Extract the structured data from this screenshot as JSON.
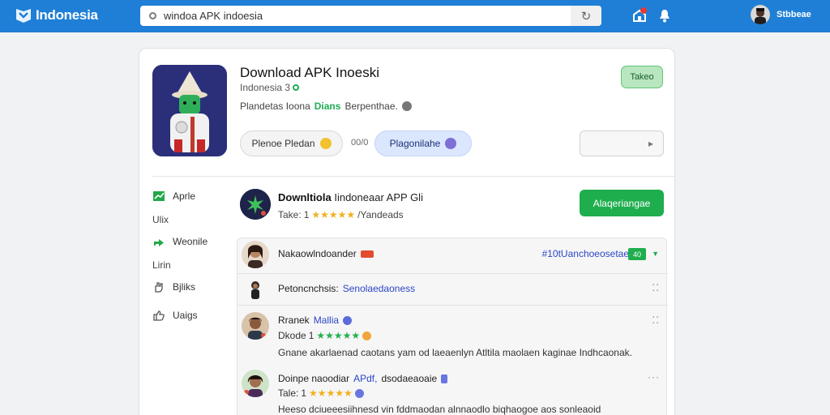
{
  "topbar": {
    "logo_text": "Indonesia",
    "search_value": "windoa APK indoesia",
    "user_name": "Stbbeae"
  },
  "app": {
    "title": "Download APK Inoeski",
    "subtitle": "Indonesia 3",
    "meta_prefix": "Plandetas Ioona",
    "meta_green": "Dians",
    "meta_suffix": "Berpenthae.",
    "badge_label": "Takeo",
    "pill_a_label": "Plenoe Pledan",
    "pill_sep": "00/0",
    "pill_b_label": "Plagonilahe"
  },
  "sidebar": {
    "items": [
      {
        "label": "Aprle",
        "icon": "chart-icon"
      },
      {
        "label": "Ulix"
      },
      {
        "label": "Weonile",
        "icon": "share-icon"
      },
      {
        "label": "Lirin"
      },
      {
        "label": "Bjliks",
        "icon": "hand-icon"
      },
      {
        "label": "Uaigs",
        "icon": "thumb-icon"
      }
    ]
  },
  "download": {
    "title_bold": "Downltiola",
    "title_rest": "Iindoneaar APP Gli",
    "rate_prefix": "Take:",
    "rate_num": "1",
    "stars": "★★★★★",
    "rate_suffix": "/Yandeads",
    "button_label": "Alaqeriangae"
  },
  "reviews": {
    "header_name": "Nakaowlndoander",
    "header_link": "#10tUanchoeosetae",
    "header_count": "40",
    "rows": [
      {
        "name": "Petoncnchsis:",
        "name_blue": "Senolaedaoness"
      },
      {
        "name": "Rranek",
        "name_blue": "Mallia",
        "rate_prefix": "Dkode",
        "rate_num": "1",
        "stars": "★★★★★",
        "text": "Gnane akarlaenad caotans yam od laeaenlyn Atltila maolaen kaginae Indhcaonak."
      },
      {
        "name": "Doinpe naoodiar",
        "name_blue": "APdf,",
        "name_rest": "dsodaeaoaie",
        "rate_prefix": "Tale:",
        "rate_num": "1",
        "stars": "★★★★★",
        "text": "Heeso dciueeesiihnesd vin fddmaodan alnnaodlo biqhaogoe aos sonleaoid"
      }
    ]
  },
  "colors": {
    "topbar": "#1f7fd6",
    "accent_green": "#1fae4e",
    "badge_green_bg": "#b8e6bf",
    "pill_blue_bg": "#dbe7ff",
    "star": "#f2b01e"
  }
}
